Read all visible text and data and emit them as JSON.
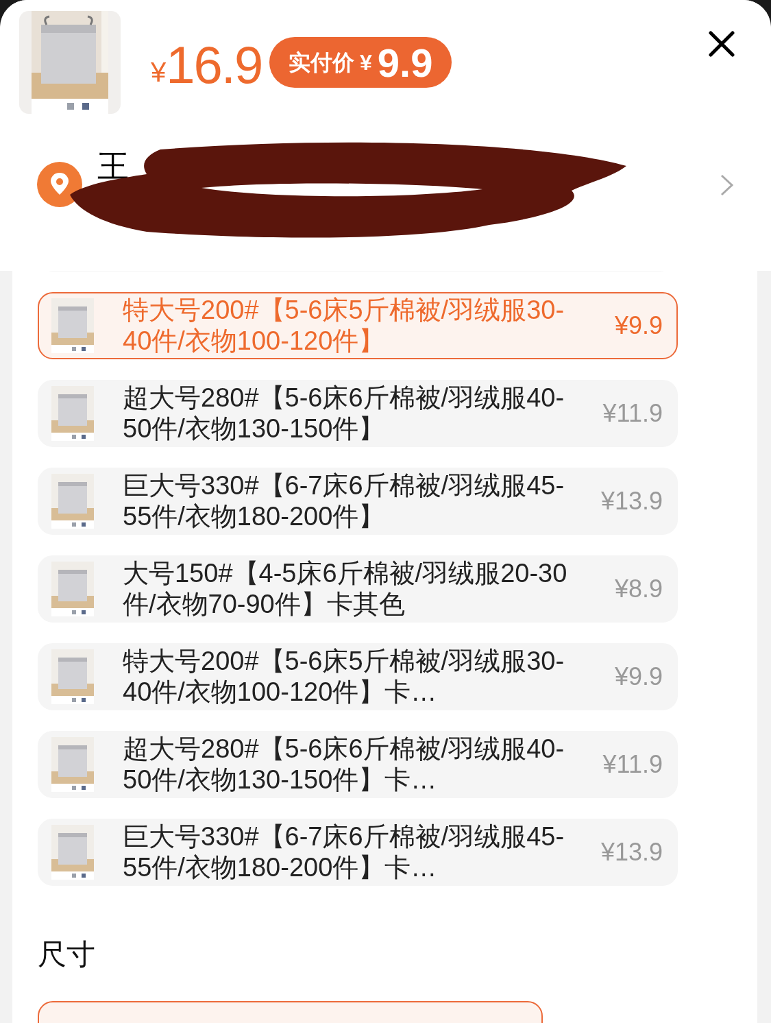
{
  "header": {
    "currency": "¥",
    "price": "16.9",
    "badge_label": "实付价",
    "badge_currency": "¥",
    "badge_price": "9.9"
  },
  "address": {
    "text": "王",
    "redacted": true
  },
  "options": [
    {
      "label": "特大号200#【5-6床5斤棉被/羽绒服30-40件/衣物100-120件】",
      "price": "¥9.9",
      "selected": true
    },
    {
      "label": "超大号280#【5-6床6斤棉被/羽绒服40-50件/衣物130-150件】",
      "price": "¥11.9",
      "selected": false
    },
    {
      "label": "巨大号330#【6-7床6斤棉被/羽绒服45-55件/衣物180-200件】",
      "price": "¥13.9",
      "selected": false
    },
    {
      "label": "大号150#【4-5床6斤棉被/羽绒服20-30件/衣物70-90件】卡其色",
      "price": "¥8.9",
      "selected": false
    },
    {
      "label": "特大号200#【5-6床5斤棉被/羽绒服30-40件/衣物100-120件】卡…",
      "price": "¥9.9",
      "selected": false
    },
    {
      "label": "超大号280#【5-6床6斤棉被/羽绒服40-50件/衣物130-150件】卡…",
      "price": "¥11.9",
      "selected": false
    },
    {
      "label": "巨大号330#【6-7床6斤棉被/羽绒服45-55件/衣物180-200件】卡…",
      "price": "¥13.9",
      "selected": false
    }
  ],
  "size_section": {
    "title": "尺寸",
    "options": [
      {
        "selected": true
      }
    ]
  }
}
